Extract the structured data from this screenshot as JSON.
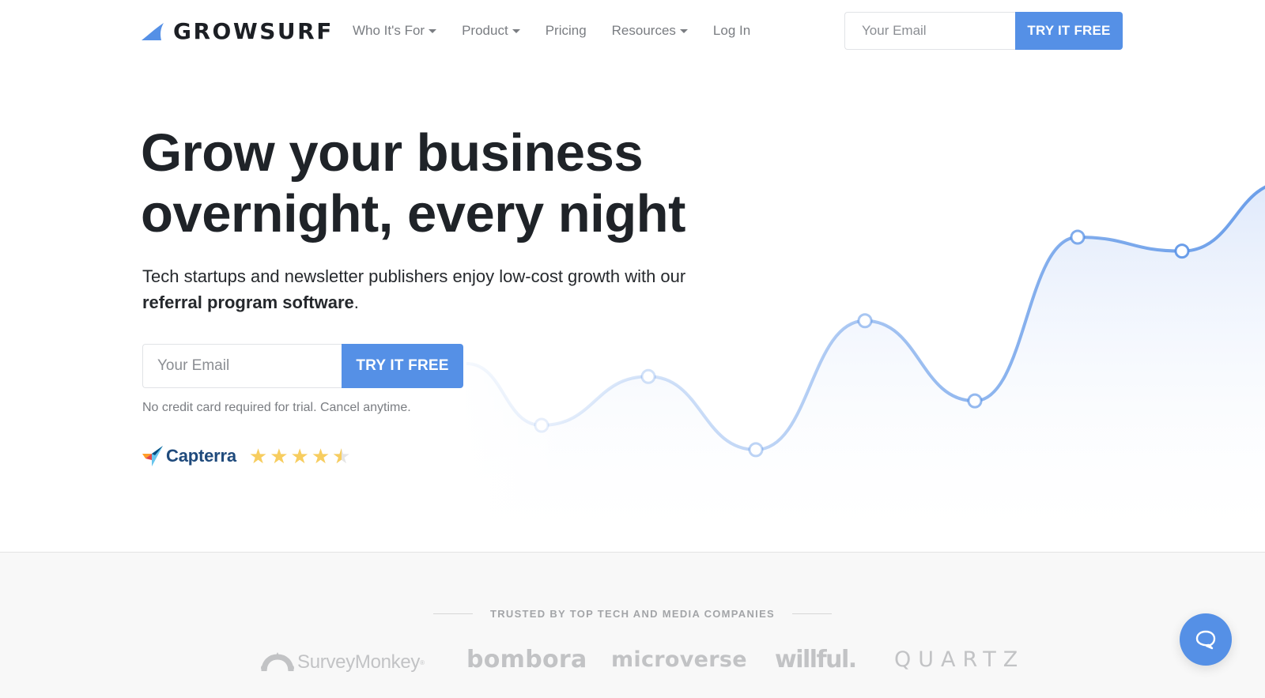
{
  "nav": {
    "brand": "GROWSURF",
    "links": [
      {
        "label": "Who It's For",
        "dropdown": true
      },
      {
        "label": "Product",
        "dropdown": true
      },
      {
        "label": "Pricing",
        "dropdown": false
      },
      {
        "label": "Resources",
        "dropdown": true
      },
      {
        "label": "Log In",
        "dropdown": false
      }
    ],
    "email_placeholder": "Your Email",
    "cta_label": "TRY IT FREE"
  },
  "hero": {
    "headline_line1": "Grow your business",
    "headline_line2": "overnight, every night",
    "subhead_text": "Tech startups and newsletter publishers enjoy low-cost growth with our ",
    "subhead_bold": "referral program software",
    "subhead_end": ".",
    "email_placeholder": "Your Email",
    "cta_label": "TRY IT FREE",
    "note": "No credit card required for trial. Cancel anytime.",
    "review": {
      "platform": "Capterra",
      "rating": 4.5,
      "max_rating": 5
    }
  },
  "trust": {
    "title": "TRUSTED BY TOP TECH AND MEDIA COMPANIES",
    "logos": [
      "SurveyMonkey",
      "bombora",
      "microverse",
      "willful.",
      "QUARTZ"
    ]
  },
  "colors": {
    "accent": "#5590e6",
    "text_dark": "#1f2328",
    "text_muted": "#7a7d82",
    "star": "#f7cd5f",
    "capterra_blue": "#1f4a7c"
  },
  "chat": {
    "icon": "chat-bubble-icon"
  },
  "chart_data": {
    "type": "area",
    "title": "",
    "xlabel": "",
    "ylabel": "",
    "grid": false,
    "note": "Decorative growth curve with no axes or labels; values are relative heights on a 0-100 scale",
    "x": [
      1,
      2,
      3,
      4,
      5,
      6,
      7,
      8,
      9
    ],
    "values": [
      30,
      44,
      23,
      60,
      37,
      84,
      80,
      100
    ],
    "ylim": [
      0,
      100
    ]
  }
}
